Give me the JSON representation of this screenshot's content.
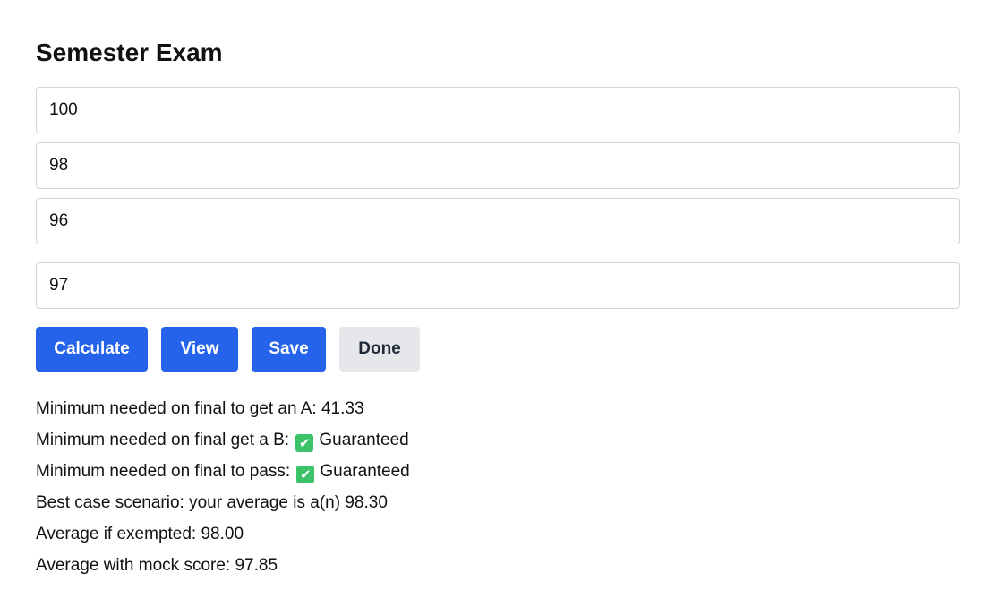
{
  "page": {
    "title": "Semester Exam"
  },
  "inputs": [
    {
      "value": "100"
    },
    {
      "value": "98"
    },
    {
      "value": "96"
    },
    {
      "value": "97"
    }
  ],
  "buttons": {
    "calculate": "Calculate",
    "view": "View",
    "save": "Save",
    "done": "Done"
  },
  "results": {
    "min_a_label": "Minimum needed on final to get an A: ",
    "min_a_value": "41.33",
    "min_b_label": "Minimum needed on final get a B: ",
    "min_b_status": "Guaranteed",
    "min_pass_label": "Minimum needed on final to pass: ",
    "min_pass_status": "Guaranteed",
    "best_case_label": "Best case scenario: your average is a(n) ",
    "best_case_value": "98.30",
    "exempt_label": "Average if exempted: ",
    "exempt_value": "98.00",
    "mock_label": "Average with mock score: ",
    "mock_value": "97.85",
    "check_icon": "check-mark-emoji"
  },
  "colors": {
    "primary_button": "#2563eb",
    "secondary_button": "#e5e7eb",
    "check_green": "#3cc36a"
  }
}
